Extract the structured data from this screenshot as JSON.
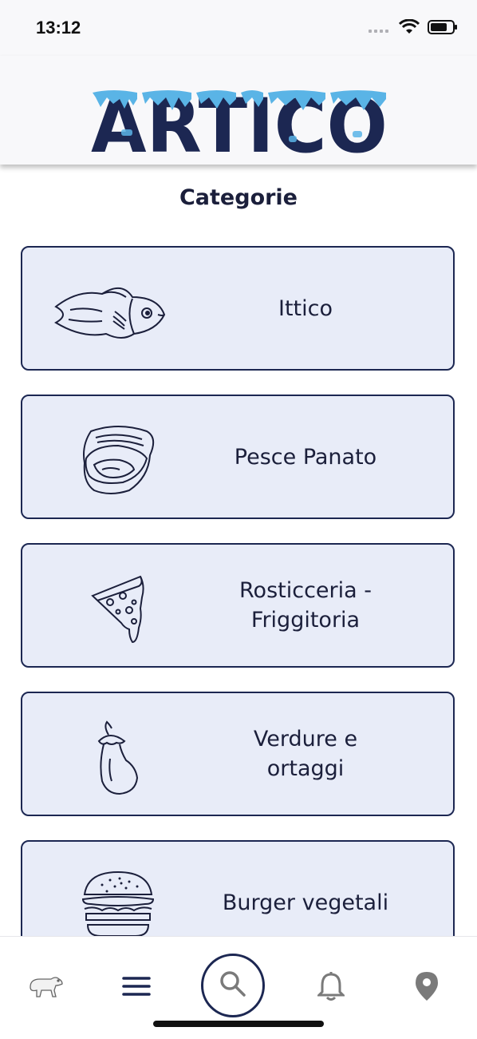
{
  "status_bar": {
    "time": "13:12"
  },
  "header": {
    "logo_text": "ARTICO"
  },
  "main": {
    "title": "Categorie",
    "categories": [
      {
        "label": "Ittico",
        "icon": "fish-icon"
      },
      {
        "label": "Pesce Panato",
        "icon": "oyster-icon"
      },
      {
        "label": "Rosticceria -\nFriggitoria",
        "icon": "pizza-slice-icon"
      },
      {
        "label": "Verdure e\nortaggi",
        "icon": "eggplant-icon"
      },
      {
        "label": "Burger vegetali",
        "icon": "burger-icon"
      }
    ]
  },
  "tab_bar": {
    "items": [
      {
        "name": "polar-bear-icon"
      },
      {
        "name": "menu-icon"
      },
      {
        "name": "search-icon"
      },
      {
        "name": "bell-icon"
      },
      {
        "name": "location-pin-icon"
      }
    ]
  },
  "colors": {
    "navy": "#1c2752",
    "card_bg": "#e8ecf8",
    "ice": "#5ab4e6"
  }
}
